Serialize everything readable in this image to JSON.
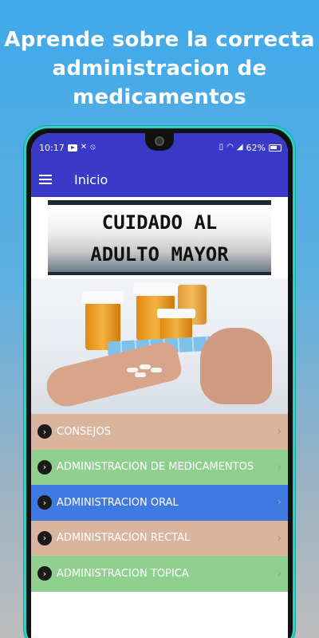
{
  "promo": {
    "title": "Aprende sobre la correcta administracion de medicamentos"
  },
  "statusbar": {
    "time": "10:17",
    "battery": "62%"
  },
  "appbar": {
    "title": "Inicio"
  },
  "banner": {
    "line1": "CUIDADO AL",
    "line2": "ADULTO MAYOR"
  },
  "menu": {
    "items": [
      {
        "label": "CONSEJOS",
        "color": "#d9b59e"
      },
      {
        "label": "ADMINISTRACION DE MEDICAMENTOS",
        "color": "#8fd08f"
      },
      {
        "label": "ADMINISTRACION ORAL",
        "color": "#3f7ae0"
      },
      {
        "label": "ADMINISTRACION RECTAL",
        "color": "#d9b59e"
      },
      {
        "label": "ADMINISTRACION TOPICA",
        "color": "#8fd08f"
      }
    ]
  },
  "colors": {
    "appbar": "#3a3ac8",
    "phone_frame": "#2fd0c2"
  }
}
